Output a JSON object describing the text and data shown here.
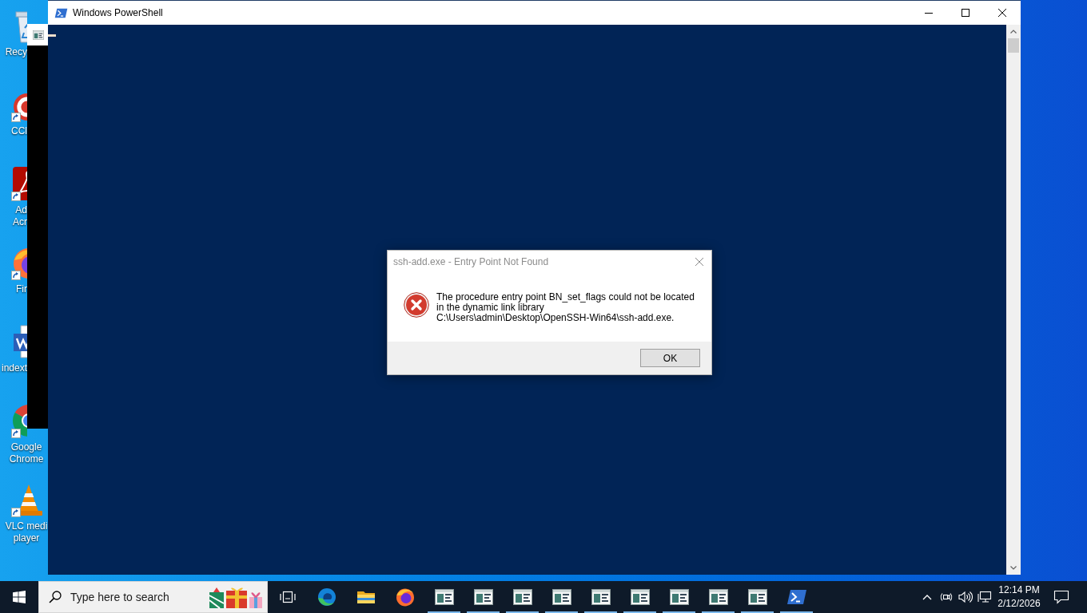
{
  "desktop": {
    "icons": [
      {
        "kind": "recycle-bin",
        "label": "Recy",
        "shortcut": false
      },
      {
        "kind": "ccleaner",
        "label": "CCl",
        "shortcut": true
      },
      {
        "kind": "acrobat",
        "label": "Ad\nAcr",
        "shortcut": true
      },
      {
        "kind": "firefox",
        "label": "Fir",
        "shortcut": true
      },
      {
        "kind": "word-document",
        "label": "indext",
        "shortcut": false
      },
      {
        "kind": "chrome",
        "label": "Google\nChrome",
        "shortcut": true
      },
      {
        "kind": "vlc",
        "label": "VLC medi\nplayer",
        "shortcut": true
      }
    ]
  },
  "window": {
    "title": "Windows PowerShell"
  },
  "dialog": {
    "title": "ssh-add.exe - Entry Point Not Found",
    "message": "The procedure entry point BN_set_flags could not be located in the dynamic link library C:\\Users\\admin\\Desktop\\OpenSSH-Win64\\ssh-add.exe.",
    "buttons": [
      "OK"
    ]
  },
  "taskbar": {
    "search": {
      "placeholder": "Type here to search"
    },
    "items": [
      {
        "kind": "edge",
        "running": false
      },
      {
        "kind": "file-explorer",
        "running": false
      },
      {
        "kind": "firefox",
        "running": false
      },
      {
        "kind": "app-window",
        "running": true
      },
      {
        "kind": "app-window",
        "running": true
      },
      {
        "kind": "app-window",
        "running": true
      },
      {
        "kind": "app-window",
        "running": true
      },
      {
        "kind": "app-window",
        "running": true
      },
      {
        "kind": "app-window",
        "running": true
      },
      {
        "kind": "app-window",
        "running": true
      },
      {
        "kind": "app-window",
        "running": true
      },
      {
        "kind": "app-window",
        "running": true
      },
      {
        "kind": "powershell",
        "running": true
      }
    ],
    "clock": {
      "time": "12:14 PM",
      "date": "2/12/2026"
    }
  }
}
